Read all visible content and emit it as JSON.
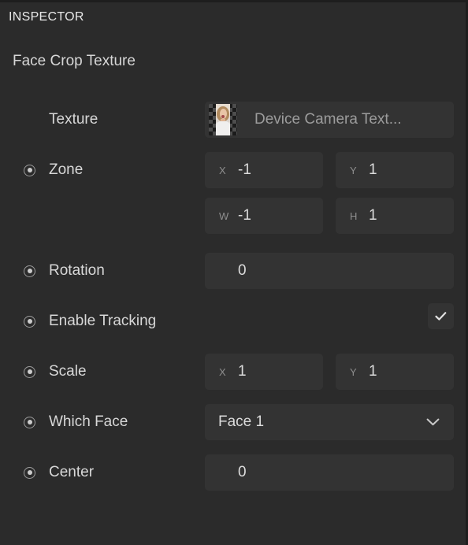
{
  "panel": {
    "header": "INSPECTOR",
    "component_title": "Face Crop Texture",
    "background_color": "#2b2b2b",
    "field_color": "#333333",
    "text_color": "#d8d8d8"
  },
  "properties": {
    "texture": {
      "label": "Texture",
      "value": "Device Camera Text...",
      "thumbnail": "face-thumbnail",
      "has_bullet": false
    },
    "zone": {
      "label": "Zone",
      "x_label": "X",
      "x_value": "-1",
      "y_label": "Y",
      "y_value": "1",
      "w_label": "W",
      "w_value": "-1",
      "h_label": "H",
      "h_value": "1"
    },
    "rotation": {
      "label": "Rotation",
      "value": "0"
    },
    "enable_tracking": {
      "label": "Enable Tracking",
      "checked": "true",
      "check_glyph": "checkmark"
    },
    "scale": {
      "label": "Scale",
      "x_label": "X",
      "x_value": "1",
      "y_label": "Y",
      "y_value": "1"
    },
    "which_face": {
      "label": "Which Face",
      "value": "Face 1",
      "chevron": "chevron-down-icon"
    },
    "center": {
      "label": "Center",
      "value": "0"
    }
  }
}
